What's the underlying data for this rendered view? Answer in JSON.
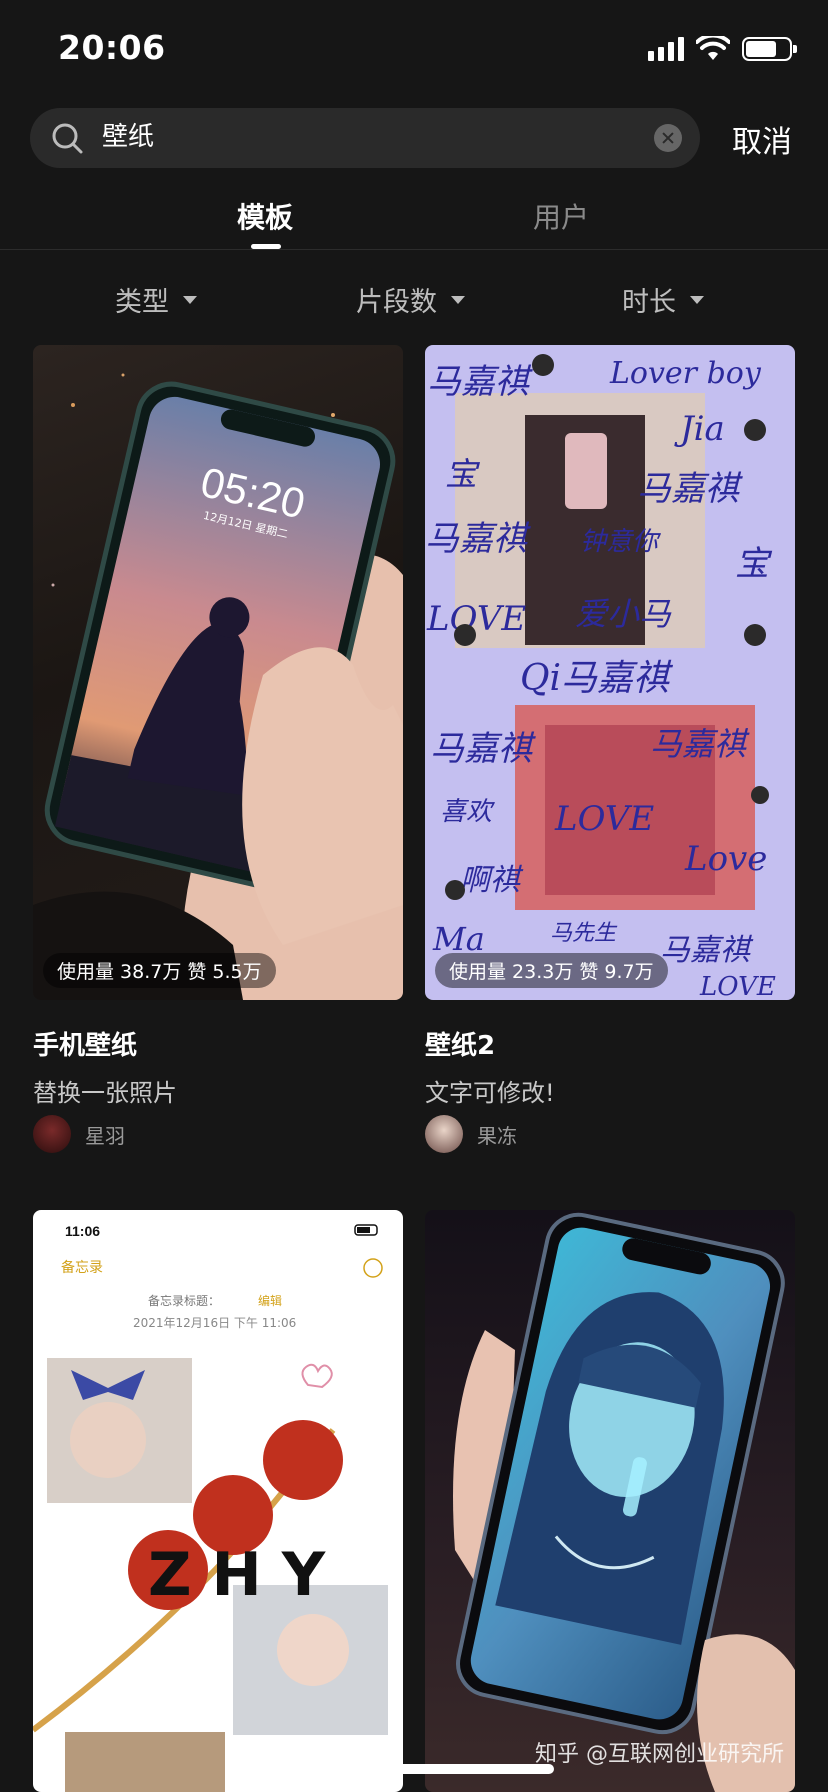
{
  "status": {
    "time": "20:06"
  },
  "search": {
    "query": "壁纸",
    "cancel": "取消"
  },
  "tabs": [
    {
      "label": "模板"
    },
    {
      "label": "用户"
    }
  ],
  "filters": [
    {
      "label": "类型"
    },
    {
      "label": "片段数"
    },
    {
      "label": "时长"
    }
  ],
  "cards": [
    {
      "stats": "使用量 38.7万 赞 5.5万",
      "title": "手机壁纸",
      "desc": "替换一张照片",
      "author": "星羽"
    },
    {
      "stats": "使用量 23.3万 赞 9.7万",
      "title": "壁纸2",
      "desc": "文字可修改!",
      "author": "果冻"
    },
    {
      "memo_time": "11:06",
      "memo_back": "备忘录",
      "memo_title": "备忘录标题：",
      "memo_edit": "编辑",
      "memo_date": "2021年12月16日 下午 11:06",
      "memo_word": "ZHY"
    },
    {}
  ],
  "phone_lock": {
    "time": "05:20",
    "date": "12月12日 星期二"
  },
  "handwriting": [
    "马嘉祺",
    "Lover boy",
    "Jia",
    "宝",
    "马嘉祺",
    "马嘉祺",
    "钟意你",
    "宝",
    "LOVE",
    "爱小马",
    "Qi马嘉祺",
    "马嘉祺",
    "马嘉祺",
    "喜欢",
    "LOVE",
    "啊祺",
    "Love",
    "Ma",
    "马先生",
    "马嘉祺",
    "LOVE"
  ],
  "watermark": "知乎 @互联网创业研究所",
  "colors": {
    "background": "#161616",
    "search_bg": "#2a2a2a",
    "card2_bg": "#c4bff0",
    "ink": "#2c2a9c"
  }
}
